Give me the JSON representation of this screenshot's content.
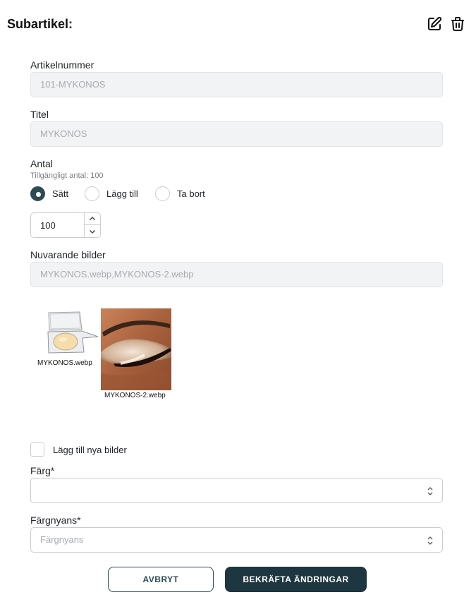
{
  "header": {
    "title": "Subartikel:",
    "edit_icon": "pencil-square-icon",
    "delete_icon": "trash-icon"
  },
  "fields": {
    "article_number": {
      "label": "Artikelnummer",
      "value": "101-MYKONOS"
    },
    "title": {
      "label": "Titel",
      "value": "MYKONOS"
    },
    "quantity": {
      "label": "Antal",
      "available": "Tillgängligt antal: 100",
      "options": [
        {
          "label": "Sätt",
          "checked": true
        },
        {
          "label": "Lägg till",
          "checked": false
        },
        {
          "label": "Ta bort",
          "checked": false
        }
      ],
      "value": "100"
    },
    "current_images": {
      "label": "Nuvarande bilder",
      "value": "MYKONOS.webp,MYKONOS-2.webp",
      "thumbnails": [
        {
          "caption": "MYKONOS.webp"
        },
        {
          "caption": "MYKONOS-2.webp"
        }
      ]
    },
    "add_new_images": {
      "label": "Lägg till nya bilder",
      "checked": false
    },
    "color": {
      "label": "Färg*",
      "value": ""
    },
    "shade": {
      "label": "Färgnyans*",
      "placeholder": "Färgnyans"
    }
  },
  "actions": {
    "cancel_label": "AVBRYT",
    "confirm_label": "BEKRÄFTA ÄNDRINGAR"
  },
  "colors": {
    "accent": "#2e4a55",
    "primary_button": "#1d3640",
    "disabled_bg": "#f2f3f4"
  }
}
